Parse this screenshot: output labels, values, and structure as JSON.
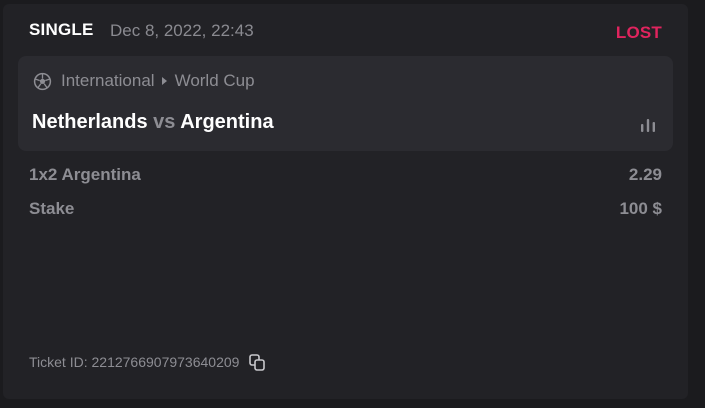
{
  "bet": {
    "type": "SINGLE",
    "date": "Dec 8, 2022, 22:43",
    "status": "LOST",
    "status_color": "#e0245e"
  },
  "event": {
    "sport_icon": "soccer-ball-icon",
    "category": "International",
    "separator_icon": "triangle-right-icon",
    "tournament": "World Cup",
    "home_team": "Netherlands",
    "vs": "vs",
    "away_team": "Argentina",
    "stats_icon": "bar-chart-icon"
  },
  "selection": {
    "label": "1x2 Argentina",
    "odds": "2.29"
  },
  "stake": {
    "label": "Stake",
    "value": "100 $"
  },
  "footer": {
    "ticket_label": "Ticket ID:",
    "ticket_id": "2212766907973640209",
    "copy_icon": "copy-icon"
  }
}
